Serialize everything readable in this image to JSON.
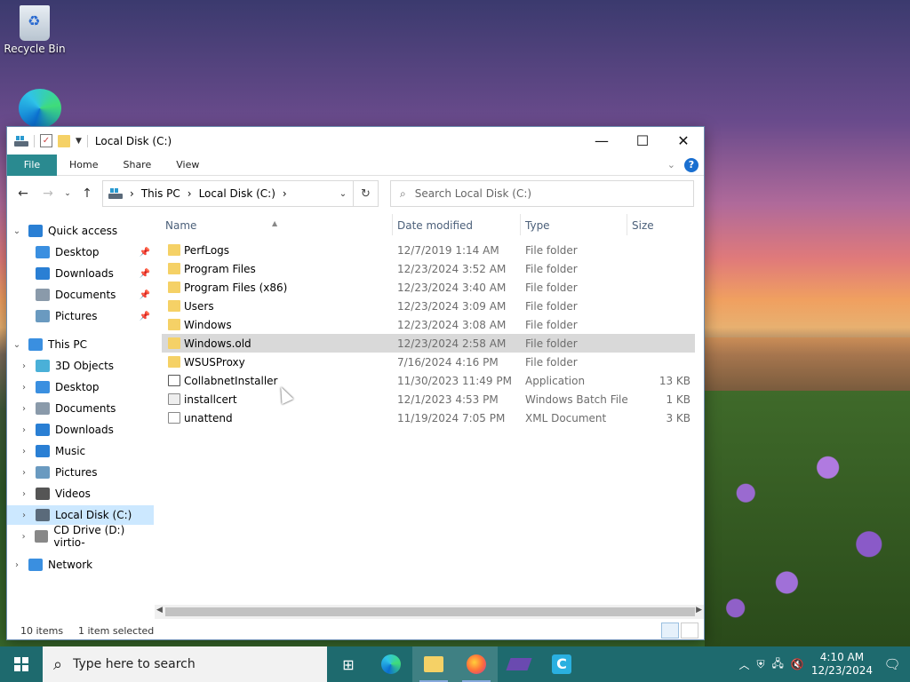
{
  "desktop": {
    "recycle_bin_label": "Recycle Bin"
  },
  "window": {
    "title": "Local Disk (C:)",
    "ribbon_tabs": [
      "File",
      "Home",
      "Share",
      "View"
    ],
    "help_label": "?",
    "address": {
      "crumbs": [
        "This PC",
        "Local Disk (C:)"
      ]
    },
    "search": {
      "placeholder": "Search Local Disk (C:)"
    },
    "columns": {
      "name": "Name",
      "date": "Date modified",
      "type": "Type",
      "size": "Size"
    },
    "nav": [
      {
        "label": "Quick access",
        "level": 0,
        "icon": "star-icon",
        "color": "#2a7fd4"
      },
      {
        "label": "Desktop",
        "level": 1,
        "icon": "desktop-icon",
        "color": "#3a8fe0",
        "pinned": true
      },
      {
        "label": "Downloads",
        "level": 1,
        "icon": "downloads-icon",
        "color": "#2a7fd4",
        "pinned": true
      },
      {
        "label": "Documents",
        "level": 1,
        "icon": "documents-icon",
        "color": "#8a9aaa",
        "pinned": true
      },
      {
        "label": "Pictures",
        "level": 1,
        "icon": "pictures-icon",
        "color": "#6a9ac0",
        "pinned": true
      },
      {
        "label": "This PC",
        "level": 0,
        "icon": "this-pc-icon",
        "color": "#3a8fe0"
      },
      {
        "label": "3D Objects",
        "level": 1,
        "icon": "3d-objects-icon",
        "color": "#4ab0d8"
      },
      {
        "label": "Desktop",
        "level": 1,
        "icon": "desktop-icon",
        "color": "#3a8fe0"
      },
      {
        "label": "Documents",
        "level": 1,
        "icon": "documents-icon",
        "color": "#8a9aaa"
      },
      {
        "label": "Downloads",
        "level": 1,
        "icon": "downloads-icon",
        "color": "#2a7fd4"
      },
      {
        "label": "Music",
        "level": 1,
        "icon": "music-icon",
        "color": "#2a7fd4"
      },
      {
        "label": "Pictures",
        "level": 1,
        "icon": "pictures-icon",
        "color": "#6a9ac0"
      },
      {
        "label": "Videos",
        "level": 1,
        "icon": "videos-icon",
        "color": "#555555"
      },
      {
        "label": "Local Disk (C:)",
        "level": 1,
        "icon": "local-disk-icon",
        "color": "#5a6a7a",
        "selected": true
      },
      {
        "label": "CD Drive (D:) virtio-",
        "level": 1,
        "icon": "cd-drive-icon",
        "color": "#888888"
      },
      {
        "label": "Network",
        "level": 0,
        "icon": "network-icon",
        "color": "#3a8fe0"
      }
    ],
    "files": [
      {
        "name": "PerfLogs",
        "date": "12/7/2019 1:14 AM",
        "type": "File folder",
        "size": "",
        "icon": "folder"
      },
      {
        "name": "Program Files",
        "date": "12/23/2024 3:52 AM",
        "type": "File folder",
        "size": "",
        "icon": "folder"
      },
      {
        "name": "Program Files (x86)",
        "date": "12/23/2024 3:40 AM",
        "type": "File folder",
        "size": "",
        "icon": "folder"
      },
      {
        "name": "Users",
        "date": "12/23/2024 3:09 AM",
        "type": "File folder",
        "size": "",
        "icon": "folder"
      },
      {
        "name": "Windows",
        "date": "12/23/2024 3:08 AM",
        "type": "File folder",
        "size": "",
        "icon": "folder"
      },
      {
        "name": "Windows.old",
        "date": "12/23/2024 2:58 AM",
        "type": "File folder",
        "size": "",
        "icon": "folder",
        "selected": true
      },
      {
        "name": "WSUSProxy",
        "date": "7/16/2024 4:16 PM",
        "type": "File folder",
        "size": "",
        "icon": "folder"
      },
      {
        "name": "CollabnetInstaller",
        "date": "11/30/2023 11:49 PM",
        "type": "Application",
        "size": "13 KB",
        "icon": "app"
      },
      {
        "name": "installcert",
        "date": "12/1/2023 4:53 PM",
        "type": "Windows Batch File",
        "size": "1 KB",
        "icon": "bat"
      },
      {
        "name": "unattend",
        "date": "11/19/2024 7:05 PM",
        "type": "XML Document",
        "size": "3 KB",
        "icon": "xml"
      }
    ],
    "status": {
      "items": "10 items",
      "selected": "1 item selected"
    }
  },
  "taskbar": {
    "search_placeholder": "Type here to search",
    "time": "4:10 AM",
    "date": "12/23/2024"
  }
}
